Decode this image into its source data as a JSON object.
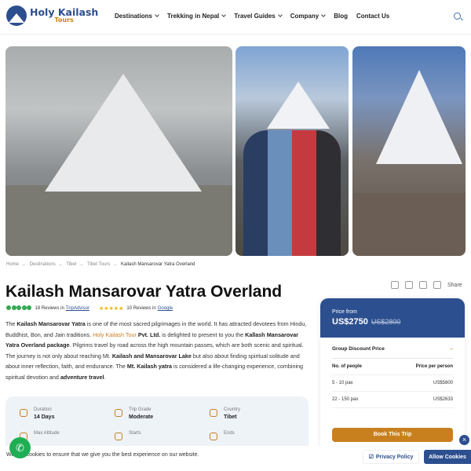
{
  "brand": {
    "line1": "Holy Kailash",
    "line2": "Tours"
  },
  "nav": [
    {
      "label": "Destinations",
      "dropdown": true
    },
    {
      "label": "Trekking in Nepal",
      "dropdown": true
    },
    {
      "label": "Travel Guides",
      "dropdown": true
    },
    {
      "label": "Company",
      "dropdown": true
    },
    {
      "label": "Blog",
      "dropdown": false
    },
    {
      "label": "Contact Us",
      "dropdown": false
    }
  ],
  "breadcrumb": [
    "Home",
    "Destinations",
    "Tibet",
    "Tibet Tours",
    "Kailash Mansarovar Yatra Overland"
  ],
  "title": "Kailash Mansarovar Yatra Overland",
  "actions": {
    "share": "Share"
  },
  "reviews": {
    "tripadvisor_count": "18 Reviews in",
    "tripadvisor_link": "TripAdvisor",
    "google_count": "10 Reviews in",
    "google_link": "Google",
    "tripadvisor_rating": 5,
    "google_rating": 5
  },
  "description": {
    "p1": "The ",
    "b1": "Kailash Mansarovar Yatra",
    "p2": " is one of the most sacred pilgrimages in the world. It has attracted devotees from Hindu, Buddhist, Bon, and Jain traditions. ",
    "link": "Holy Kailash Tour",
    "b2": " Pvt. Ltd.",
    "p3": " is delighted to present to you the ",
    "b3": "Kallash Mansarovar Yatra Overland package",
    "p4": ". Pilgrims travel by road across the high mountain passes, which are both scenic and spiritual. The journey is not only about reaching Mt. ",
    "b4": "Kailash and Mansarovar Lake",
    "p5": " but also about finding spiritual solitude and about inner reflection, faith, and endurance. The ",
    "b5": "Mt. Kailash yatra",
    "p6": " is considered a life-changing experience, combining spiritual devotion and ",
    "b6": "adventure travel",
    "p7": "."
  },
  "facts": [
    {
      "label": "Duration",
      "value": "14 Days",
      "icon": "calendar-icon"
    },
    {
      "label": "Trip Grade",
      "value": "Moderate",
      "icon": "gauge-icon"
    },
    {
      "label": "Country",
      "value": "Tibet",
      "icon": "globe-icon"
    },
    {
      "label": "Max Altitude",
      "value": "",
      "icon": "mountain-icon"
    },
    {
      "label": "Starts",
      "value": "",
      "icon": "flag-icon"
    },
    {
      "label": "Ends",
      "value": "",
      "icon": "flag-icon"
    }
  ],
  "price": {
    "from_label": "Price from",
    "current": "US$2750",
    "old": "US$2800",
    "group_heading": "Group Discount Price",
    "collapse_symbol": "–",
    "columns": [
      "No. of people",
      "Price per person"
    ],
    "rows": [
      {
        "people": "5 - 10 pax",
        "price": "US$5800"
      },
      {
        "people": "22 - 150 pax",
        "price": "US$2633"
      }
    ],
    "book_label": "Book This Trip"
  },
  "cookie": {
    "text": "We use cookies to ensure that we give you the best experience on our website.",
    "privacy_label": "Privacy Policy",
    "allow_label": "Allow Cookies"
  },
  "colors": {
    "brand_blue": "#2c4f8f",
    "accent_orange": "#c8801f",
    "whatsapp_green": "#1fae54"
  }
}
